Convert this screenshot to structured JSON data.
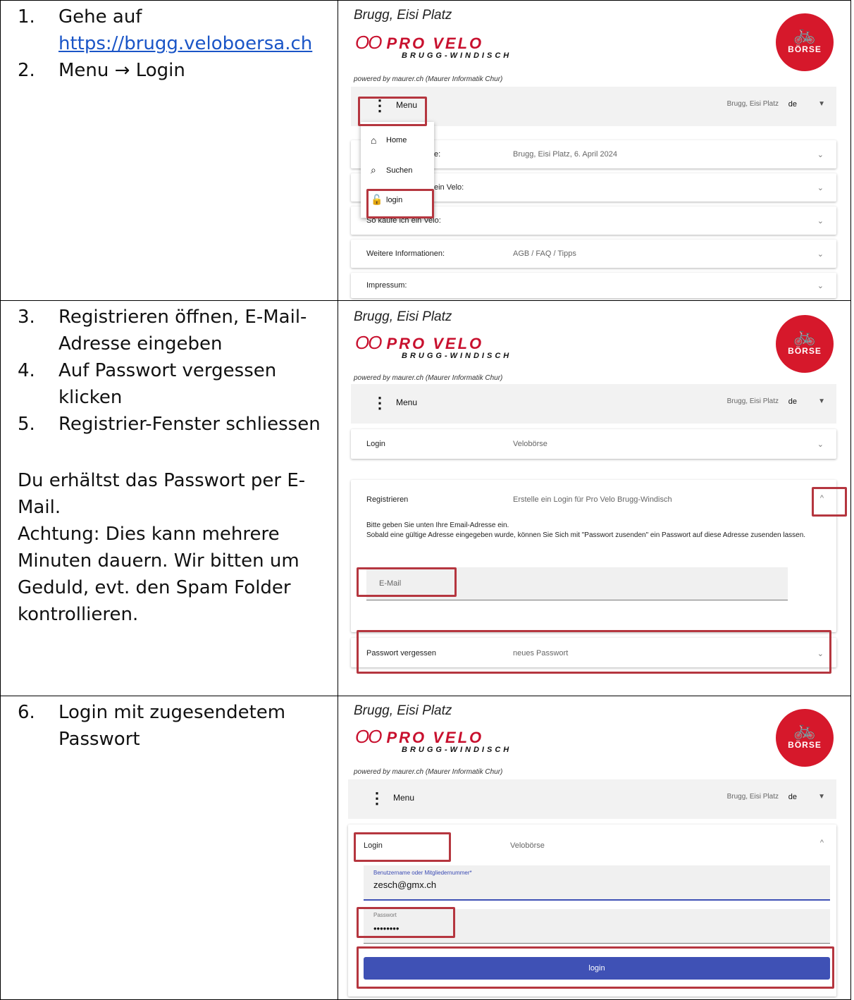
{
  "left": {
    "row1": {
      "steps": [
        {
          "num": "1.",
          "text": "Gehe auf",
          "link": "https://brugg.veloboersa.ch"
        },
        {
          "num": "2.",
          "text": "Menu → Login"
        }
      ]
    },
    "row2": {
      "steps": [
        {
          "num": "3.",
          "text": "Registrieren öffnen, E-Mail-Adresse eingeben"
        },
        {
          "num": "4.",
          "text": "Auf Passwort vergessen klicken"
        },
        {
          "num": "5.",
          "text": "Registrier-Fenster schliessen"
        }
      ],
      "para1": "Du erhältst das Passwort per E-Mail.",
      "para2": "Achtung: Dies kann mehrere Minuten dauern. Wir bitten um Geduld, evt. den Spam Folder kontrollieren."
    },
    "row3": {
      "steps": [
        {
          "num": "6.",
          "text": "Login mit zugesendetem Passwort"
        }
      ]
    }
  },
  "header": {
    "place": "Brugg, Eisi Platz",
    "rings": "OO",
    "brand": "PRO VELO",
    "sub": "BRUGG-WINDISCH",
    "badge_icon": "bicycle-icon",
    "badge_text": "BÖRSE",
    "powered": "powered by maurer.ch (Maurer Informatik Chur)"
  },
  "menubar": {
    "icon": "⋮",
    "label": "Menu",
    "location": "Brugg, Eisi Platz",
    "lang": "de",
    "caret": "▼"
  },
  "shot1": {
    "dropdown": [
      {
        "icon": "home-icon",
        "glyph": "⌂",
        "label": "Home"
      },
      {
        "icon": "search-icon",
        "glyph": "🔍",
        "label": "Suchen"
      },
      {
        "icon": "lock-icon",
        "glyph": "🔓",
        "label": "login"
      }
    ],
    "cards": [
      {
        "c1": "e:",
        "c2": "Brugg, Eisi Platz, 6. April 2024"
      },
      {
        "c1": "ein Velo:",
        "c2": ""
      },
      {
        "c1": "So kaufe ich ein Velo:",
        "c2": ""
      },
      {
        "c1": "Weitere Informationen:",
        "c2": "AGB / FAQ / Tipps"
      },
      {
        "c1": "Impressum:",
        "c2": ""
      }
    ],
    "chevron": "⌄"
  },
  "shot2": {
    "login_card": {
      "c1": "Login",
      "c2": "Velobörse"
    },
    "register_card": {
      "c1": "Registrieren",
      "c2": "Erstelle ein Login für Pro Velo Brugg-Windisch",
      "chevron_up": "^"
    },
    "info1": "Bitte geben Sie unten Ihre Email-Adresse ein.",
    "info2": "Sobald eine gültige Adresse eingegeben wurde, können Sie Sich mit \"Passwort zusenden\" ein Passwort auf diese Adresse zusenden lassen.",
    "email_placeholder": "E-Mail",
    "forgot_card": {
      "c1": "Passwort vergessen",
      "c2": "neues Passwort"
    }
  },
  "shot3": {
    "login_card": {
      "c1": "Login",
      "c2": "Velobörse"
    },
    "username_label": "Benutzername oder Mitgliedernummer*",
    "username_value": "zesch@gmx.ch",
    "password_label": "Passwort",
    "password_value": "••••••••",
    "button": "login"
  }
}
